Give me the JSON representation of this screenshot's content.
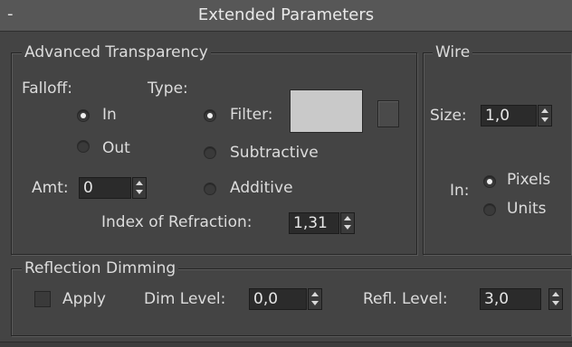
{
  "header": {
    "collapse_symbol": "-",
    "title": "Extended Parameters"
  },
  "advanced_transparency": {
    "title": "Advanced Transparency",
    "falloff_label": "Falloff:",
    "type_label": "Type:",
    "falloff_options": [
      {
        "label": "In",
        "selected": true
      },
      {
        "label": "Out",
        "selected": false
      }
    ],
    "type_options": [
      {
        "label": "Filter:",
        "selected": true
      },
      {
        "label": "Subtractive",
        "selected": false
      },
      {
        "label": "Additive",
        "selected": false
      }
    ],
    "filter_color": "#c9c9c9",
    "amt_label": "Amt:",
    "amt_value": "0",
    "ior_label": "Index of Refraction:",
    "ior_value": "1,31"
  },
  "wire": {
    "title": "Wire",
    "size_label": "Size:",
    "size_value": "1,0",
    "in_label": "In:",
    "units_options": [
      {
        "label": "Pixels",
        "selected": true
      },
      {
        "label": "Units",
        "selected": false
      }
    ]
  },
  "reflection_dimming": {
    "title": "Reflection Dimming",
    "apply_label": "Apply",
    "apply_checked": false,
    "dim_level_label": "Dim Level:",
    "dim_level_value": "0,0",
    "refl_level_label": "Refl. Level:",
    "refl_level_value": "3,0"
  }
}
